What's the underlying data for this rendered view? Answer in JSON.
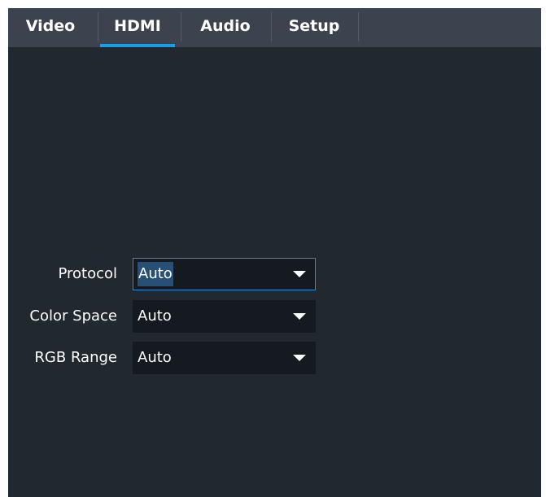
{
  "tabs": [
    {
      "label": "Video"
    },
    {
      "label": "HDMI",
      "active": true
    },
    {
      "label": "Audio"
    },
    {
      "label": "Setup"
    }
  ],
  "hdmi": {
    "protocol": {
      "label": "Protocol",
      "value": "Auto"
    },
    "color_space": {
      "label": "Color Space",
      "value": "Auto"
    },
    "rgb_range": {
      "label": "RGB Range",
      "value": "Auto"
    }
  },
  "icons": {
    "dropdown": "chevron-down-icon"
  },
  "colors": {
    "background": "#222830",
    "tabbar": "#3d434e",
    "accent": "#1a9ce6",
    "select_bg": "#151a20",
    "focus_border": "#2b8fd6",
    "selection_highlight": "#284f76"
  }
}
